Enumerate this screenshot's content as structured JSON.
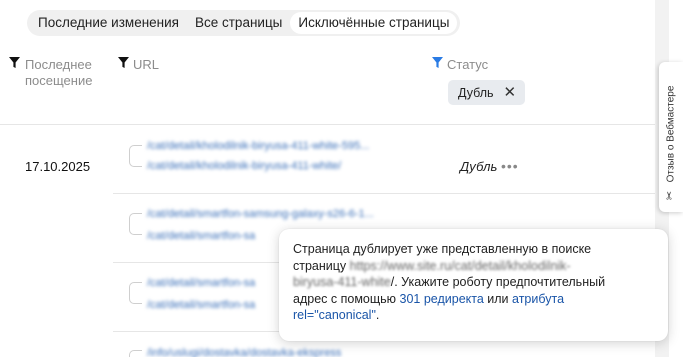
{
  "tabs": [
    {
      "label": "Последние изменения"
    },
    {
      "label": "Все страницы"
    },
    {
      "label": "Исключённые страницы"
    }
  ],
  "columns": {
    "last_visit": "Последнее посещение",
    "url": "URL",
    "status": "Статус"
  },
  "filter_chip": {
    "label": "Дубль",
    "close": "✕"
  },
  "rows": [
    {
      "date": "17.10.2025",
      "url_primary": "/cat/detail/kholodilnik-biryusa-411-white-595...",
      "url_secondary": "/cat/detail/kholodilnik-biryusa-411-white/",
      "status": "Дубль",
      "more": "•••"
    },
    {
      "url_primary": "/cat/detail/smartfon-samsung-galaxy-s26-6-1...",
      "url_secondary": "/cat/detail/smartfon-sa"
    },
    {
      "url_primary": "/cat/detail/smartfon-sa",
      "url_secondary": "/cat/detail/smartfon-sa"
    },
    {
      "url_primary": "/info/uslugi/dostavka/dostavka-ekspress"
    }
  ],
  "tooltip": {
    "line1": "Страница дублирует уже представленную в поиске",
    "line2_prefix": "страницу ",
    "line2_url": "https://www.site.ru/cat/detail/kholodilnik-",
    "line3_url": "biryusa-411-white",
    "line3_suffix": "/. Укажите роботу предпочтительный",
    "line4_prefix": "адрес с помощью ",
    "link1": "301 редиректа",
    "line4_mid": " или ",
    "link2": "атрибута",
    "link3": "rel=\"canonical\"",
    "line5_suffix": "."
  },
  "feedback": {
    "label": "Отзыв о Вебмастере"
  },
  "colors": {
    "accent_filter": "#2a7be4",
    "link": "#1a55a8"
  }
}
